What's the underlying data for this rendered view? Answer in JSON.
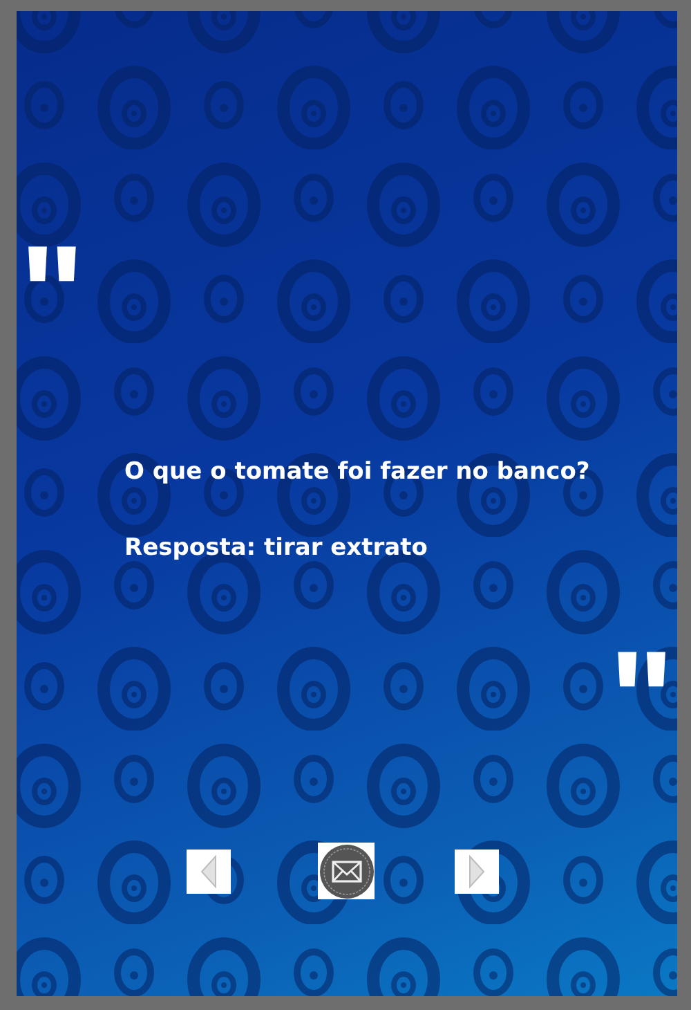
{
  "quotes": {
    "open": "\"",
    "close": "\""
  },
  "question": "O que o tomate foi fazer no banco?",
  "answer": "Resposta: tirar extrato",
  "buttons": [
    {
      "kind": "previous"
    },
    {
      "kind": "share"
    },
    {
      "kind": "next"
    }
  ]
}
